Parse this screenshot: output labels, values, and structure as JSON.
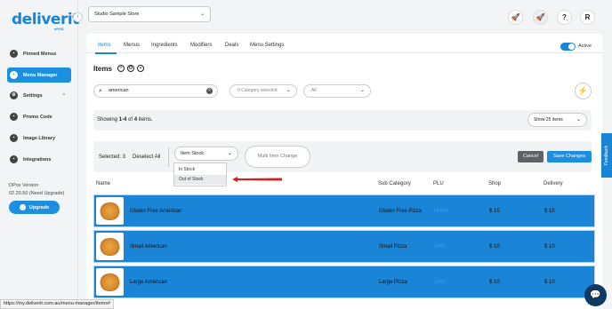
{
  "brand": {
    "logo": "deliverit",
    "logo_sub": "ePOS"
  },
  "sidebar": {
    "items": [
      {
        "label": "Pinned Menus",
        "icon": "pin-icon"
      },
      {
        "label": "Menu Manager",
        "icon": "menu-manager-icon"
      },
      {
        "label": "Settings",
        "icon": "settings-icon"
      },
      {
        "label": "Promo Code",
        "icon": "promo-icon"
      },
      {
        "label": "Image Library",
        "icon": "image-icon"
      },
      {
        "label": "Integrations",
        "icon": "integrations-icon"
      }
    ],
    "version_title": "DPos Version",
    "version_value": "02.20.50 (Need Upgrade)",
    "upgrade_label": "Upgrade"
  },
  "topbar": {
    "store": "Studio Sample Store",
    "avatar_initial": "R"
  },
  "tabs": [
    "Items",
    "Menus",
    "Ingredients",
    "Modifiers",
    "Deals",
    "Menu Settings"
  ],
  "active_label": "Active",
  "items_title": "Items",
  "search": {
    "value": "american"
  },
  "filters": {
    "category_placeholder": "0 Category selected",
    "all_placeholder": "All"
  },
  "showing": {
    "prefix": "Showing ",
    "range": "1-4",
    "middle": " of ",
    "total": "4",
    "suffix": " items."
  },
  "per_page": "Show 25 items",
  "actions": {
    "selected": "Selected: 3",
    "deselect": "Deselect All",
    "stock_select": "Item Stock",
    "multi_change": "Multi Item Change",
    "cancel": "Cancel",
    "save": "Save Changes"
  },
  "stock_options": [
    "In Stock",
    "Out of Stock"
  ],
  "columns": {
    "name": "Name",
    "sub_category": "Sub Category",
    "plu": "PLU",
    "shop": "Shop",
    "delivery": "Delivery"
  },
  "rows": [
    {
      "name": "Gluten Free American",
      "sub_category": "Gluten Free Pizza",
      "plu": "GFP02",
      "shop": "$ 15",
      "delivery": "$ 15"
    },
    {
      "name": "Small American",
      "sub_category": "Small Pizza",
      "plu": "SP02",
      "shop": "$ 10",
      "delivery": "$ 10"
    },
    {
      "name": "Large American",
      "sub_category": "Large Pizza",
      "plu": "LP02",
      "shop": "$ 10",
      "delivery": "$ 10"
    }
  ],
  "feedback": "Feedback",
  "status_url": "https://my.deliverit.com.au/menu-manager/items#",
  "colors": {
    "accent": "#1a84d6",
    "row_highlight": "#1a84d6",
    "cancel": "#5f6368"
  }
}
